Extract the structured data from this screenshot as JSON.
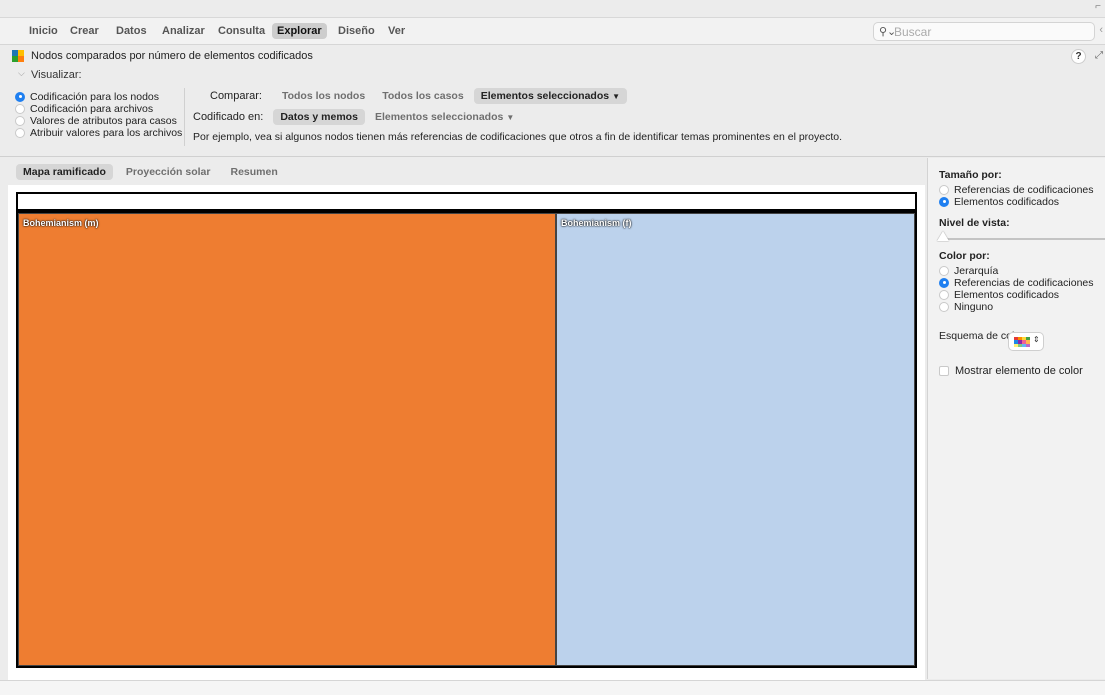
{
  "menubar": {
    "items": [
      "Inicio",
      "Crear",
      "Datos",
      "Analizar",
      "Consulta",
      "Explorar",
      "Diseño",
      "Ver"
    ],
    "active": "Explorar"
  },
  "search": {
    "placeholder": "Buscar",
    "icon": "search-icon"
  },
  "title": {
    "text": "Nodos comparados por número de elementos codificados",
    "help": "?"
  },
  "visualize": {
    "label": "Visualizar:",
    "options": [
      {
        "label": "Codificación para los nodos",
        "selected": true
      },
      {
        "label": "Codificación para archivos",
        "selected": false
      },
      {
        "label": "Valores de atributos para casos",
        "selected": false
      },
      {
        "label": "Atribuir valores para los archivos",
        "selected": false
      }
    ]
  },
  "compare": {
    "label": "Comparar:",
    "options": [
      "Todos los nodos",
      "Todos los casos",
      "Elementos seleccionados"
    ],
    "selected": "Elementos seleccionados"
  },
  "coded_in": {
    "label": "Codificado en:",
    "options": [
      "Datos y memos",
      "Elementos seleccionados"
    ],
    "selected": "Datos y memos"
  },
  "example_text": "Por ejemplo, vea si algunos nodos tienen más referencias de codificaciones que otros a fin de identificar temas prominentes en el proyecto.",
  "view_tabs": {
    "items": [
      "Mapa ramificado",
      "Proyección solar",
      "Resumen"
    ],
    "active": "Mapa ramificado"
  },
  "chart_data": {
    "type": "treemap",
    "nodes": [
      {
        "name": "Bohemianism (m)",
        "size_share": 0.6,
        "color": "#ee7d31"
      },
      {
        "name": "Bohemianism (f)",
        "size_share": 0.4,
        "color": "#bcd2ec"
      }
    ]
  },
  "right_panel": {
    "size_by": {
      "label": "Tamaño por:",
      "options": [
        {
          "label": "Referencias de codificaciones",
          "selected": false
        },
        {
          "label": "Elementos codificados",
          "selected": true
        }
      ]
    },
    "view_level": {
      "label": "Nivel de vista:",
      "value": 0
    },
    "color_by": {
      "label": "Color por:",
      "options": [
        {
          "label": "Jerarquía",
          "selected": false
        },
        {
          "label": "Referencias de codificaciones",
          "selected": true
        },
        {
          "label": "Elementos codificados",
          "selected": false
        },
        {
          "label": "Ninguno",
          "selected": false
        }
      ]
    },
    "color_scheme": {
      "label": "Esquema de colores:",
      "swatches": [
        "#e53935",
        "#fb8c00",
        "#fdd835",
        "#43a047",
        "#1e88e5",
        "#8e24aa",
        "#f06292",
        "#ffb74d",
        "#fff176",
        "#81c784",
        "#64b5f6",
        "#ba68c8"
      ]
    },
    "show_color_item": {
      "label": "Mostrar elemento de color",
      "checked": false
    }
  }
}
